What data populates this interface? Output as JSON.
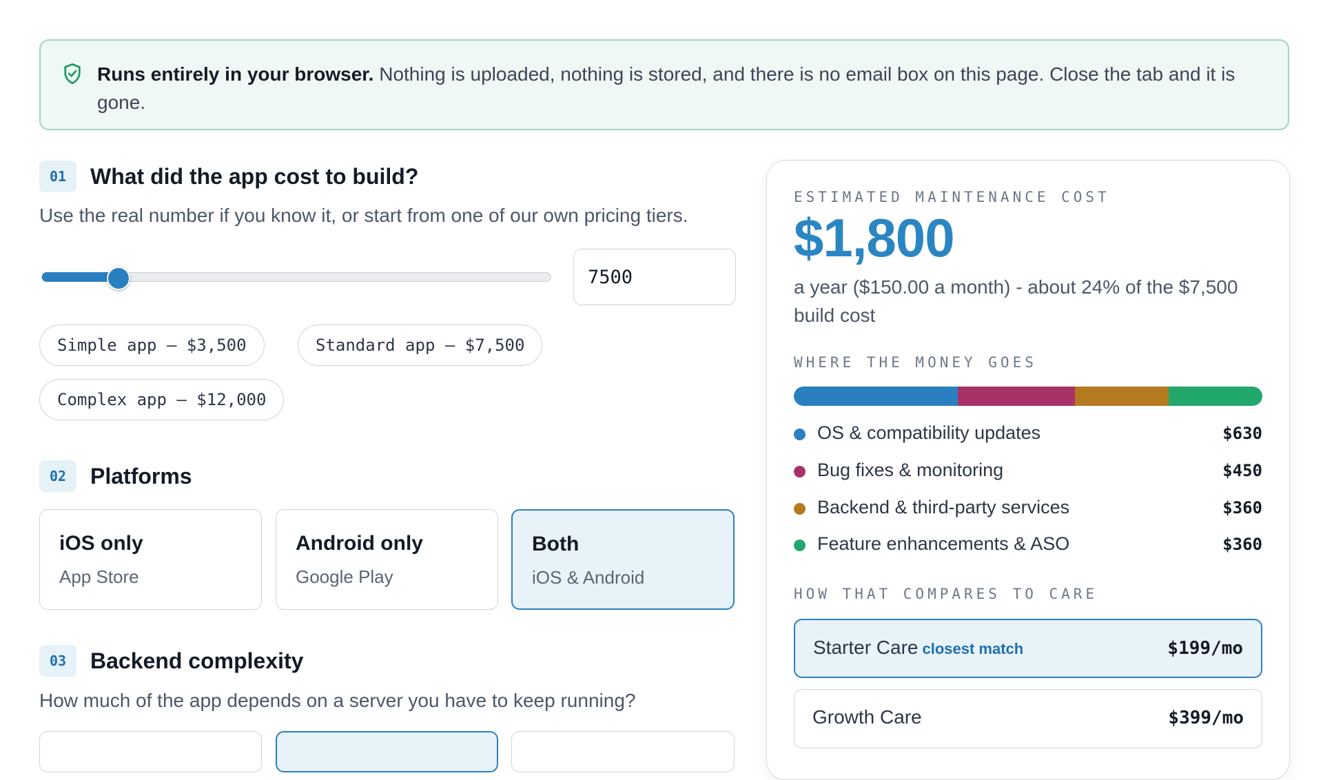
{
  "notice": {
    "strong": "Runs entirely in your browser.",
    "text": " Nothing is uploaded, nothing is stored, and there is no email box on this page. Close the tab and it is gone."
  },
  "step1": {
    "num": "01",
    "title": "What did the app cost to build?",
    "desc": "Use the real number if you know it, or start from one of our own pricing tiers.",
    "slider": {
      "min": 1000,
      "max": 50000,
      "value": 7500
    },
    "input_value": "7500",
    "presets": [
      "Simple app — $3,500",
      "Standard app — $7,500",
      "Complex app — $12,000"
    ]
  },
  "step2": {
    "num": "02",
    "title": "Platforms",
    "options": [
      {
        "title": "iOS only",
        "sub": "App Store",
        "selected": false
      },
      {
        "title": "Android only",
        "sub": "Google Play",
        "selected": false
      },
      {
        "title": "Both",
        "sub": "iOS & Android",
        "selected": true
      }
    ]
  },
  "step3": {
    "num": "03",
    "title": "Backend complexity",
    "desc": "How much of the app depends on a server you have to keep running?"
  },
  "result": {
    "kicker": "ESTIMATED MAINTENANCE COST",
    "total": "$1,800",
    "sub": "a year ($150.00 a month) - about 24% of the $7,500 build cost",
    "breakdown_kicker": "WHERE THE MONEY GOES",
    "breakdown": [
      {
        "label": "OS & compatibility updates",
        "amount": "$630",
        "value": 630,
        "color": "#2a7fc0"
      },
      {
        "label": "Bug fixes & monitoring",
        "amount": "$450",
        "value": 450,
        "color": "#a83266"
      },
      {
        "label": "Backend & third-party services",
        "amount": "$360",
        "value": 360,
        "color": "#b5791f"
      },
      {
        "label": "Feature enhancements & ASO",
        "amount": "$360",
        "value": 360,
        "color": "#23a86b"
      }
    ],
    "compare_kicker": "HOW THAT COMPARES TO CARE",
    "plans": [
      {
        "name": "Starter Care",
        "tag": "closest match",
        "price": "$199/mo"
      },
      {
        "name": "Growth Care",
        "tag": "",
        "price": "$399/mo"
      }
    ]
  }
}
